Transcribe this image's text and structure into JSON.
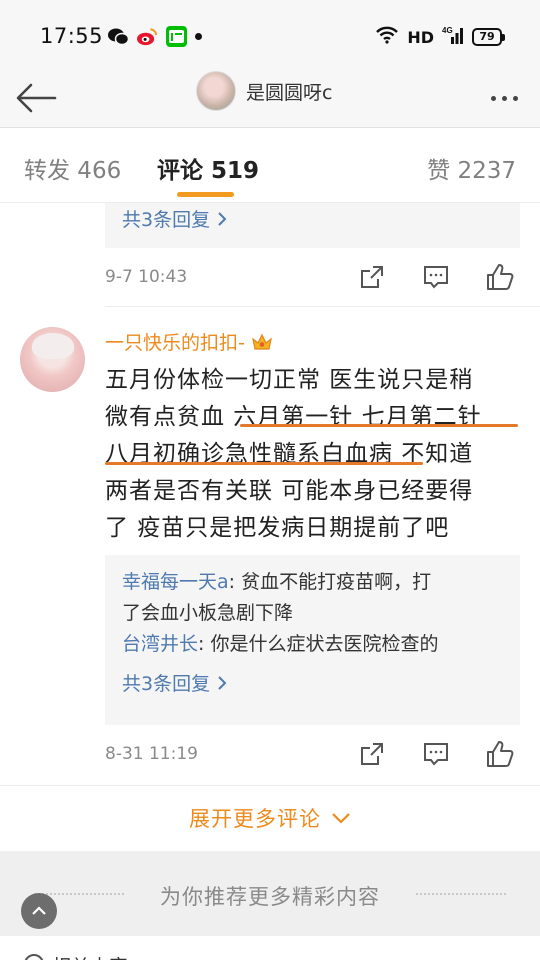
{
  "status_bar": {
    "time": "17:55",
    "network": "HD",
    "battery": "79"
  },
  "nav": {
    "username": "是圆圆呀c"
  },
  "tabs": {
    "repost": "转发 466",
    "comments": "评论 519",
    "likes": "赞 2237"
  },
  "prev_comment": {
    "replies_more": "共3条回复",
    "date": "9-7 10:43"
  },
  "comment": {
    "author": "一只快乐的扣扣-",
    "lines": [
      "五月份体检一切正常  医生说只是稍",
      "微有点贫血  六月第一针  七月第二针",
      "八月初确诊急性髓系白血病  不知道",
      "两者是否有关联  可能本身已经要得",
      "了  疫苗只是把发病日期提前了吧"
    ],
    "replies": [
      {
        "user": "幸福每一天a",
        "text": ": 贫血不能打疫苗啊，打",
        "cont": "了会血小板急剧下降"
      },
      {
        "user": "台湾井长",
        "text": ": 你是什么症状去医院检查的"
      }
    ],
    "replies_more": "共3条回复",
    "date": "8-31 11:19"
  },
  "expand_label": "展开更多评论",
  "recommend_label": "为你推荐更多精彩内容",
  "related_label": "相关内容",
  "colors": {
    "accent": "#f39b20",
    "link": "#4f7ab0",
    "username_orange": "#ee8a1c",
    "underline": "#e67a2b"
  }
}
